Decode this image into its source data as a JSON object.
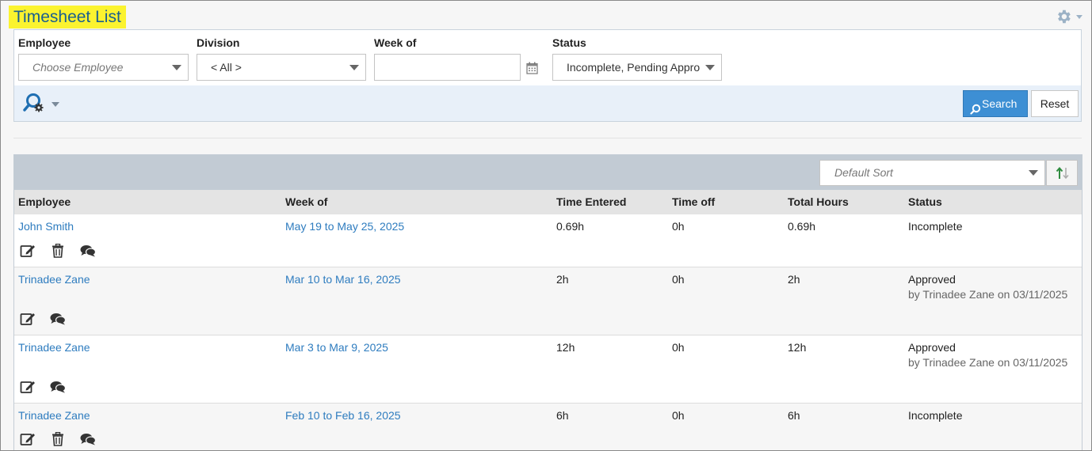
{
  "page": {
    "title": "Timesheet List"
  },
  "icons": {
    "settings": "gear-icon",
    "calendar": "calendar-icon",
    "advanced_search": "search-settings-icon",
    "edit": "edit-icon",
    "delete": "trash-icon",
    "comments": "comments-icon",
    "sort_direction": "sort-arrows-icon"
  },
  "colors": {
    "title_highlight": "#fbf32f",
    "title_text": "#1a5f8f",
    "link": "#2e7cbf",
    "primary_button": "#3d8fd4"
  },
  "filters": {
    "employee": {
      "label": "Employee",
      "placeholder": "Choose Employee"
    },
    "division": {
      "label": "Division",
      "value": "< All >"
    },
    "week_of": {
      "label": "Week of",
      "value": ""
    },
    "status": {
      "label": "Status",
      "value": "Incomplete, Pending Appro"
    }
  },
  "actions": {
    "search_label": "Search",
    "reset_label": "Reset"
  },
  "sort": {
    "placeholder": "Default Sort"
  },
  "table": {
    "columns": [
      "Employee",
      "Week of",
      "Time Entered",
      "Time off",
      "Total Hours",
      "Status"
    ],
    "rows": [
      {
        "employee": "John Smith",
        "week_of": "May 19 to May 25, 2025",
        "time_entered": "0.69h",
        "time_off": "0h",
        "total_hours": "0.69h",
        "status": "Incomplete",
        "status_detail": "",
        "can_delete": true
      },
      {
        "employee": "Trinadee Zane",
        "week_of": "Mar 10 to Mar 16, 2025",
        "time_entered": "2h",
        "time_off": "0h",
        "total_hours": "2h",
        "status": "Approved",
        "status_detail": "by Trinadee Zane on 03/11/2025",
        "can_delete": false
      },
      {
        "employee": "Trinadee Zane",
        "week_of": "Mar 3 to Mar 9, 2025",
        "time_entered": "12h",
        "time_off": "0h",
        "total_hours": "12h",
        "status": "Approved",
        "status_detail": "by Trinadee Zane on 03/11/2025",
        "can_delete": false
      },
      {
        "employee": "Trinadee Zane",
        "week_of": "Feb 10 to Feb 16, 2025",
        "time_entered": "6h",
        "time_off": "0h",
        "total_hours": "6h",
        "status": "Incomplete",
        "status_detail": "",
        "can_delete": true
      }
    ]
  }
}
